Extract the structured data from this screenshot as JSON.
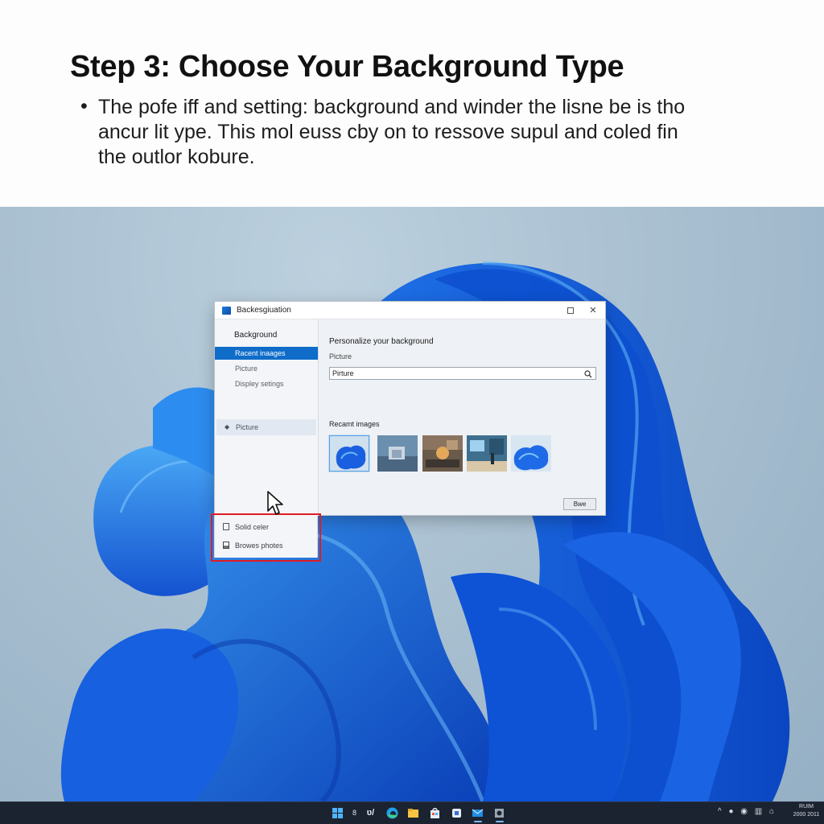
{
  "tutorial": {
    "title": "Step 3: Choose Your Background Type",
    "bullet": "•",
    "text_lines": [
      "The pofe iff and setting: background and winder the lisne be is tho",
      "ancur lit ype. This mol euss cby on to ressove supul and coled fin",
      "the outlor kobure."
    ]
  },
  "window": {
    "title": "Backesgiuation",
    "close_glyph": "✕",
    "icon": "app-icon"
  },
  "sidebar": {
    "heading": "Background",
    "items": [
      {
        "label": "Racent inaages",
        "selected": true
      },
      {
        "label": "Picture",
        "selected": false
      },
      {
        "label": "Displey setings",
        "selected": false
      }
    ],
    "select_label": "Picture",
    "select_icon": "chevron-updown-icon"
  },
  "main": {
    "heading": "Personalize your background",
    "sub_label": "Picture",
    "field_value": "Pirture",
    "field_icon": "search-icon",
    "recent_label": "Recamt images",
    "thumbnails": [
      {
        "name": "blue-bloom",
        "selected": true
      },
      {
        "name": "gray-landscape",
        "selected": false
      },
      {
        "name": "amber-interior",
        "selected": false
      },
      {
        "name": "blue-interior",
        "selected": false
      },
      {
        "name": "blue-bloom-alt",
        "selected": false
      }
    ],
    "save_label": "Bwe"
  },
  "flyout": {
    "items": [
      {
        "label": "Solid celer",
        "icon": "square-icon"
      },
      {
        "label": "Browes photes",
        "icon": "photo-icon"
      }
    ]
  },
  "taskbar": {
    "icons": [
      "start-icon",
      "search-icon",
      "copilot-icon",
      "edge-icon",
      "file-explorer-icon",
      "store-icon",
      "teams-icon",
      "mail-icon",
      "settings-icon"
    ],
    "tray_glyphs": "^ ● ◉ ▥ ⌂",
    "clock_line1": "RUIM",
    "clock_line2": "2000 2011"
  },
  "colors": {
    "accent": "#0f6cc9",
    "highlight": "#e01b24",
    "taskbar": "#1c2330",
    "bloom": "#1a5fe0"
  }
}
